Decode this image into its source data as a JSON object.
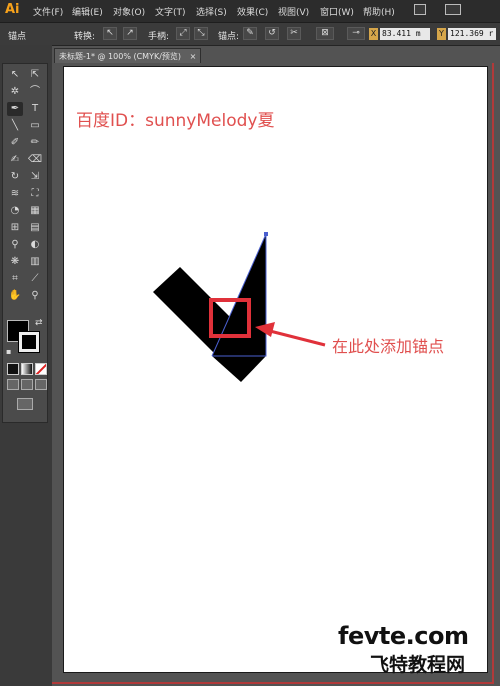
{
  "app": {
    "logo": "Ai"
  },
  "menubar": {
    "items": [
      "文件(F)",
      "编辑(E)",
      "对象(O)",
      "文字(T)",
      "选择(S)",
      "效果(C)",
      "视图(V)",
      "窗口(W)",
      "帮助(H)"
    ]
  },
  "control_bar": {
    "tool_name": "锚点",
    "convert_label": "转换:",
    "handles_label": "手柄:",
    "anchor_label": "锚点:",
    "x_value": "83.411 m",
    "y_value": "121.369 r",
    "x_symbol": "X",
    "y_symbol": "Y"
  },
  "document": {
    "tab_title": "未标题-1* @ 100% (CMYK/预览)",
    "tab_close": "×"
  },
  "canvas": {
    "watermark": "百度ID：sunnyMelody夏",
    "annotation": "在此处添加锚点",
    "site_logo": "fevte.com",
    "site_name": "飞特教程网"
  },
  "colors": {
    "menubar_bg": "#2c2c2c",
    "annotation_red": "#e0504f",
    "highlight_red": "#e0313a",
    "path_blue": "#4a5fd0",
    "ai_orange": "#f7a21b"
  }
}
